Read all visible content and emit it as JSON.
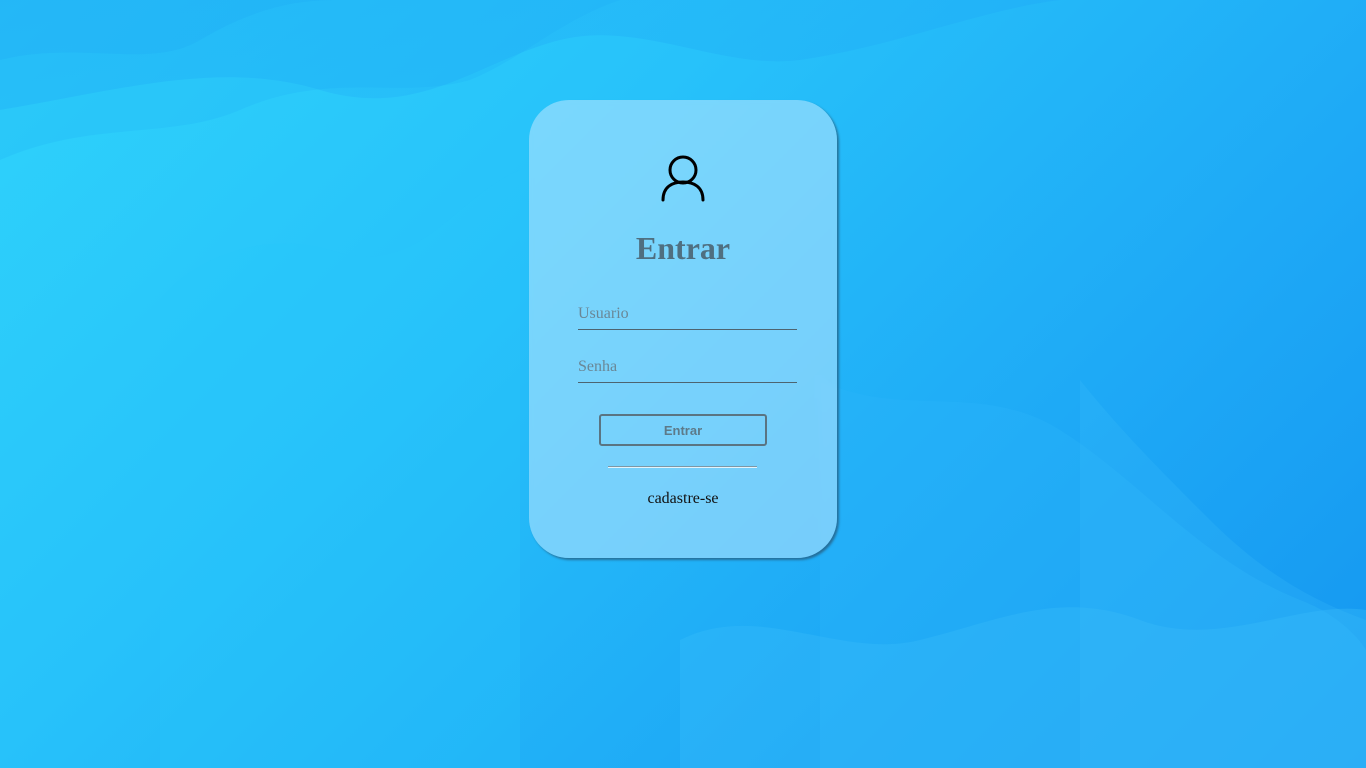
{
  "login": {
    "title": "Entrar",
    "username_placeholder": "Usuario",
    "username_value": "",
    "password_placeholder": "Senha",
    "password_value": "",
    "submit_label": "Entrar",
    "signup_link": "cadastre-se"
  },
  "icons": {
    "avatar": "user-icon"
  },
  "colors": {
    "background_start": "#2fd3fb",
    "background_end": "#1496f0",
    "card_tint": "#bee8ff",
    "title": "#4f6f80",
    "button_border": "#5a7482"
  }
}
